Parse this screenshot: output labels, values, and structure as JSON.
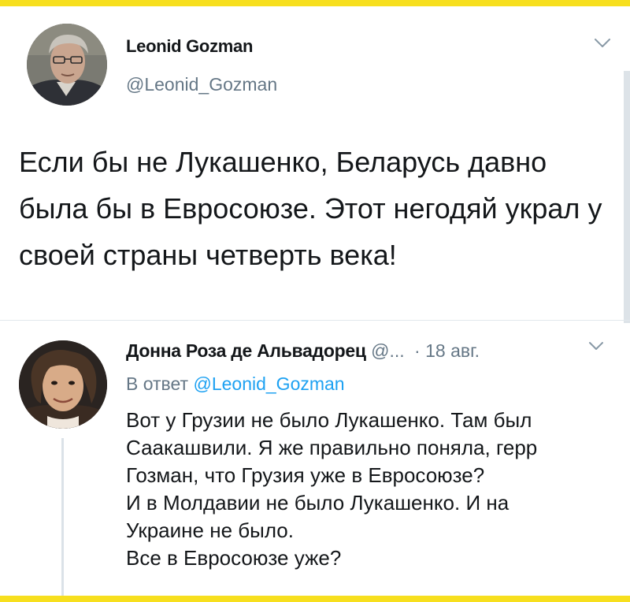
{
  "tweet": {
    "author_name": "Leonid Gozman",
    "author_handle": "@Leonid_Gozman",
    "text": "Если бы не Лукашенко, Беларусь давно была бы в Евросоюзе. Этот негодяй украл у своей страны четверть века!",
    "menu_icon": "chevron-down-icon"
  },
  "reply": {
    "author_name": "Донна Роза де Альвадорец",
    "author_handle": "@...",
    "separator": "·",
    "date": "18 авг.",
    "reply_to_prefix": "В ответ",
    "reply_to_handle": "@Leonid_Gozman",
    "lines": [
      "Вот у Грузии не было Лукашенко. Там был",
      "Саакашвили. Я же правильно поняла, герр",
      "Гозман, что Грузия уже в Евросоюзе?",
      "И в Молдавии не было Лукашенко. И на",
      "Украине не было.",
      "Все в Евросоюзе уже?"
    ],
    "menu_icon": "chevron-down-icon"
  },
  "colors": {
    "frame_border": "#f7df1e",
    "text_primary": "#14171a",
    "text_secondary": "#657786",
    "link": "#1da1f2",
    "divider": "#e2e8ec"
  }
}
